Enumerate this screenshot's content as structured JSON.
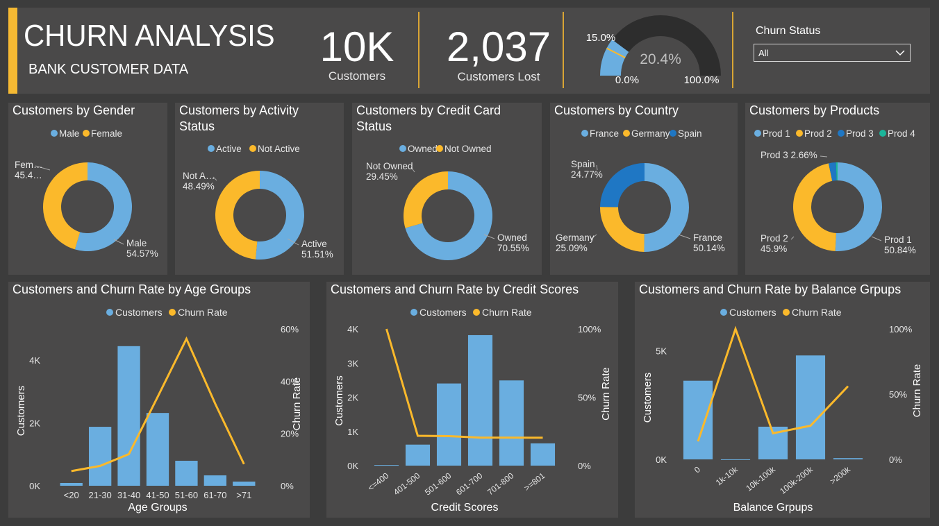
{
  "header": {
    "title": "CHURN ANALYSIS",
    "subtitle": "BANK CUSTOMER DATA",
    "kpi_customers": {
      "value": "10K",
      "label": "Customers"
    },
    "kpi_lost": {
      "value": "2,037",
      "label": "Customers Lost"
    },
    "gauge": {
      "value_label": "20.4%",
      "value": 20.4,
      "target_label": "15.0%",
      "target": 15.0,
      "min_label": "0.0%",
      "max_label": "100.0%"
    },
    "slicer": {
      "label": "Churn Status",
      "value": "All"
    }
  },
  "colors": {
    "blue": "#6aaee0",
    "yellow": "#fbb92b",
    "dark_blue": "#1f77c4",
    "teal": "#1bb59a",
    "panel": "#4a4949",
    "accent": "#f5b933"
  },
  "donuts": [
    {
      "title": "Customers by Gender",
      "legend": [
        {
          "name": "Male",
          "color": "#6aaee0"
        },
        {
          "name": "Female",
          "color": "#fbb92b"
        }
      ],
      "values": [
        54.57,
        45.43
      ],
      "labels": [
        {
          "name": "Male",
          "pct": "54.57%"
        },
        {
          "name": "Fem…",
          "pct": "45.4…"
        }
      ]
    },
    {
      "title": "Customers by Activity Status",
      "legend": [
        {
          "name": "Active",
          "color": "#6aaee0"
        },
        {
          "name": "Not Active",
          "color": "#fbb92b"
        }
      ],
      "values": [
        51.51,
        48.49
      ],
      "labels": [
        {
          "name": "Active",
          "pct": "51.51%"
        },
        {
          "name": "Not A…",
          "pct": "48.49%"
        }
      ]
    },
    {
      "title": "Customers by Credit Card Status",
      "legend": [
        {
          "name": "Owned",
          "color": "#6aaee0"
        },
        {
          "name": "Not Owned",
          "color": "#fbb92b"
        }
      ],
      "values": [
        70.55,
        29.45
      ],
      "labels": [
        {
          "name": "Owned",
          "pct": "70.55%"
        },
        {
          "name": "Not Owned",
          "pct": "29.45%"
        }
      ]
    },
    {
      "title": "Customers by Country",
      "legend": [
        {
          "name": "France",
          "color": "#6aaee0"
        },
        {
          "name": "Germany",
          "color": "#fbb92b"
        },
        {
          "name": "Spain",
          "color": "#1f77c4"
        }
      ],
      "values": [
        50.14,
        25.09,
        24.77
      ],
      "labels": [
        {
          "name": "France",
          "pct": "50.14%"
        },
        {
          "name": "Germany",
          "pct": "25.09%"
        },
        {
          "name": "Spain",
          "pct": "24.77%"
        }
      ]
    },
    {
      "title": "Customers by Products",
      "legend": [
        {
          "name": "Prod 1",
          "color": "#6aaee0"
        },
        {
          "name": "Prod 2",
          "color": "#fbb92b"
        },
        {
          "name": "Prod 3",
          "color": "#1f77c4"
        },
        {
          "name": "Prod 4",
          "color": "#1bb59a"
        }
      ],
      "values": [
        50.84,
        45.9,
        2.66,
        0.6
      ],
      "labels": [
        {
          "name": "Prod 1",
          "pct": "50.84%"
        },
        {
          "name": "Prod 2",
          "pct": "45.9%"
        },
        {
          "name": "Prod 3 2.66%",
          "pct": ""
        }
      ]
    }
  ],
  "chart_data": [
    {
      "type": "bar",
      "title": "Customers and Churn Rate by Age Groups",
      "xlabel": "Age Groups",
      "ylabel": "Customers",
      "y2label": "Churn Rate",
      "categories": [
        "<20",
        "21-30",
        "31-40",
        "41-50",
        "51-60",
        "61-70",
        ">71"
      ],
      "series": [
        {
          "name": "Customers",
          "type": "bar",
          "values": [
            89,
            1879,
            4451,
            2320,
            797,
            331,
            133
          ]
        },
        {
          "name": "Churn Rate",
          "type": "line",
          "values": [
            5.6,
            7.6,
            12.1,
            34.0,
            56.2,
            31.4,
            8.3
          ]
        }
      ],
      "ylim": [
        0,
        5000
      ],
      "y2lim": [
        0,
        60
      ],
      "yticks": [
        "0K",
        "2K",
        "4K"
      ],
      "y2ticks": [
        "0%",
        "20%",
        "40%",
        "60%"
      ],
      "legend": "top-center"
    },
    {
      "type": "bar",
      "title": "Customers and Churn Rate by Credit Scores",
      "xlabel": "Credit Scores",
      "ylabel": "Customers",
      "y2label": "Churn Rate",
      "categories": [
        "<=400",
        "401-500",
        "501-600",
        "601-700",
        "701-800",
        ">=801"
      ],
      "series": [
        {
          "name": "Customers",
          "type": "bar",
          "values": [
            19,
            615,
            2404,
            3818,
            2493,
            651
          ]
        },
        {
          "name": "Churn Rate",
          "type": "line",
          "values": [
            100,
            21.8,
            21.6,
            20.5,
            20.5,
            20.4
          ]
        }
      ],
      "ylim": [
        0,
        4000
      ],
      "y2lim": [
        0,
        100
      ],
      "yticks": [
        "0K",
        "1K",
        "2K",
        "3K",
        "4K"
      ],
      "y2ticks": [
        "0%",
        "50%",
        "100%"
      ],
      "legend": "top-center"
    },
    {
      "type": "bar",
      "title": "Customers and Churn Rate by Balance Grpups",
      "xlabel": "Balance Grpups",
      "ylabel": "Customers",
      "y2label": "Churn Rate",
      "categories": [
        "0",
        "1k-10k",
        "10k-100k",
        "100k-200k",
        ">200k"
      ],
      "series": [
        {
          "name": "Customers",
          "type": "bar",
          "values": [
            3617,
            2,
            1503,
            4780,
            57
          ]
        },
        {
          "name": "Churn Rate",
          "type": "line",
          "values": [
            13.8,
            100,
            20.0,
            25.8,
            56.1
          ]
        }
      ],
      "ylim": [
        0,
        6000
      ],
      "y2lim": [
        0,
        100
      ],
      "yticks": [
        "0K",
        "5K"
      ],
      "y2ticks": [
        "0%",
        "50%",
        "100%"
      ],
      "legend": "top-center"
    }
  ]
}
